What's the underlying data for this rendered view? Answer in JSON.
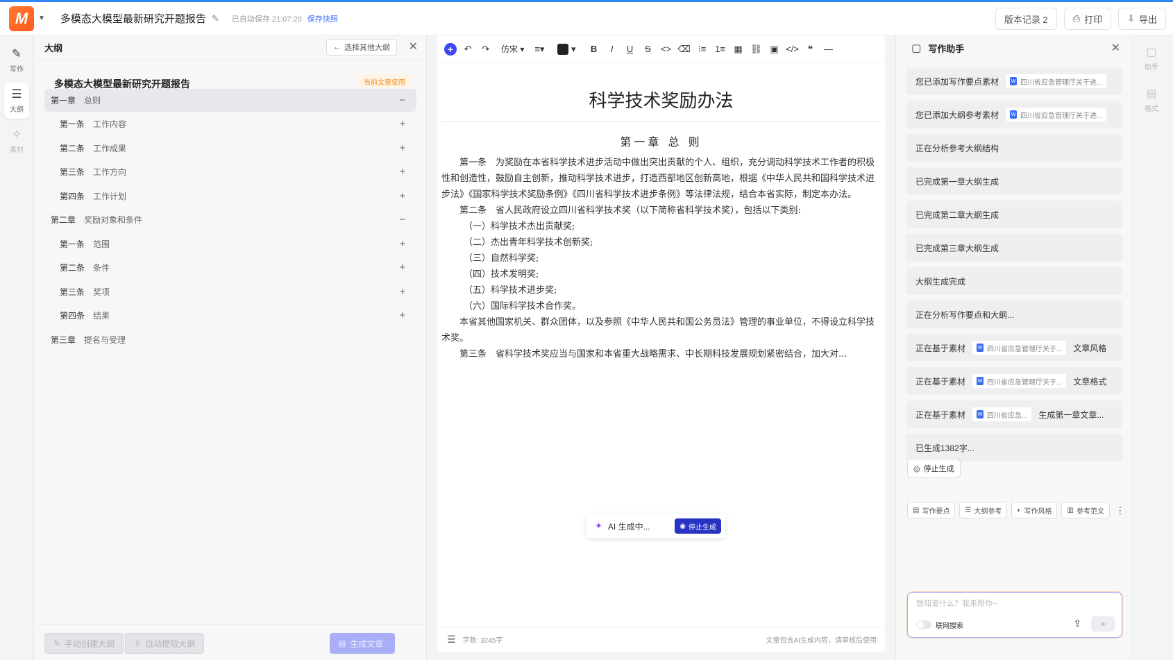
{
  "header": {
    "doc_title": "多模态大模型最新研究开题报告",
    "autosave": "已自动保存 21:07:20",
    "snapshot": "保存快照",
    "version_btn": "版本记录 2",
    "print_btn": "打印",
    "export_btn": "导出"
  },
  "left_rail": {
    "items": [
      {
        "label": "写作",
        "icon": "pen-icon"
      },
      {
        "label": "大纲",
        "icon": "outline-icon"
      },
      {
        "label": "素材",
        "icon": "material-icon"
      }
    ]
  },
  "outline": {
    "title": "大纲",
    "select_other": "选择其他大纲",
    "doc_name": "多模态大模型最新研究开题报告",
    "use_badge": "当前文章使用",
    "rows": [
      {
        "num": "第一章",
        "name": "总则",
        "action": "−"
      },
      {
        "num": "第一条",
        "name": "工作内容",
        "action": "+"
      },
      {
        "num": "第二条",
        "name": "工作成果",
        "action": "+"
      },
      {
        "num": "第三条",
        "name": "工作方向",
        "action": "+"
      },
      {
        "num": "第四条",
        "name": "工作计划",
        "action": "+"
      },
      {
        "num": "第二章",
        "name": "奖励对象和条件",
        "action": "−"
      },
      {
        "num": "第一条",
        "name": "范围",
        "action": "+"
      },
      {
        "num": "第二条",
        "name": "条件",
        "action": "+"
      },
      {
        "num": "第三条",
        "name": "奖项",
        "action": "+"
      },
      {
        "num": "第四条",
        "name": "结果",
        "action": "+"
      },
      {
        "num": "第三章",
        "name": "提名与受理",
        "action": ""
      }
    ],
    "manual_btn": "手动创建大纲",
    "auto_btn": "自动提取大纲",
    "generate_btn": "生成文章"
  },
  "toolbar": {
    "font": "仿宋"
  },
  "editor": {
    "title": "科学技术奖励办法",
    "chapter": "第一章 总 则",
    "paragraphs": [
      "第一条　为奖励在本省科学技术进步活动中做出突出贡献的个人、组织，充分调动科学技术工作者的积极性和创造性，鼓励自主创新，推动科学技术进步，打造西部地区创新高地，根据《中华人民共和国科学技术进步法》《国家科学技术奖励条例》《四川省科学技术进步条例》等法律法规，结合本省实际，制定本办法。",
      "第二条　省人民政府设立四川省科学技术奖（以下简称省科学技术奖），包括以下类别:",
      "（一）科学技术杰出贡献奖;",
      "（二）杰出青年科学技术创新奖;",
      "（三）自然科学奖;",
      "（四）技术发明奖;",
      "（五）科学技术进步奖;",
      "（六）国际科学技术合作奖。",
      "本省其他国家机关、群众团体，以及参照《中华人民共和国公务员法》管理的事业单位，不得设立科学技术奖。",
      "第三条　省科学技术奖应当与国家和本省重大战略需求、中长期科技发展规划紧密结合，加大对..."
    ],
    "ai_status": "AI 生成中...",
    "ai_stop": "停止生成",
    "word_count": "字数:  3245字",
    "ai_note": "文章包含AI生成内容，请审核后使用"
  },
  "assistant": {
    "title": "写作助手",
    "messages": [
      {
        "text": "您已添加写作要点素材",
        "chip": "四川省应急管理厅关于进...",
        "tail": ""
      },
      {
        "text": "您已添加大纲参考素材",
        "chip": "四川省应急管理厅关于进...",
        "tail": ""
      },
      {
        "text": "正在分析参考大纲结构",
        "chip": "",
        "tail": ""
      },
      {
        "text": "已完成第一章大纲生成",
        "chip": "",
        "tail": ""
      },
      {
        "text": "已完成第二章大纲生成",
        "chip": "",
        "tail": ""
      },
      {
        "text": "已完成第三章大纲生成",
        "chip": "",
        "tail": ""
      },
      {
        "text": "大纲生成完成",
        "chip": "",
        "tail": ""
      },
      {
        "text": "正在分析写作要点和大纲...",
        "chip": "",
        "tail": ""
      },
      {
        "text": "正在基于素材",
        "chip": "四川省应急管理厅关于...",
        "tail": "文章风格"
      },
      {
        "text": "正在基于素材",
        "chip": "四川省应急管理厅关于...",
        "tail": "文章格式"
      },
      {
        "text": "正在基于素材",
        "chip": "四川省应急...",
        "tail": "生成第一章文章..."
      },
      {
        "text": "已生成1382字...",
        "chip": "",
        "tail": ""
      }
    ],
    "stop_btn": "停止生成",
    "quick": [
      "写作要点",
      "大纲参考",
      "写作风格",
      "参考范文"
    ],
    "input_placeholder": "想知道什么？我来帮你~",
    "net_search": "联网搜索"
  },
  "right_rail": {
    "items": [
      {
        "label": "助手",
        "icon": "chat-icon"
      },
      {
        "label": "格式",
        "icon": "format-icon"
      }
    ]
  }
}
